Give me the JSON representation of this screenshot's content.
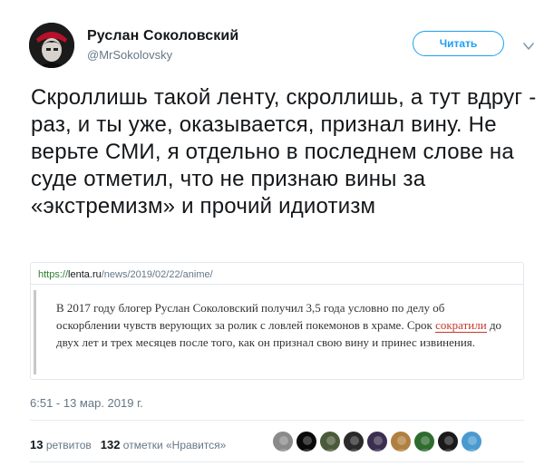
{
  "author": {
    "name": "Руслан Соколовский",
    "handle": "@MrSokolovsky"
  },
  "follow_label": "Читать",
  "tweet_text": "Скроллишь такой ленту, скроллишь, а тут вдруг - раз, и ты уже, оказывается, признал вину. Не верьте СМИ, я отдельно в последнем слове на суде отметил, что не признаю вины за «экстремизм» и прочий идиотизм",
  "card": {
    "url_scheme": "https://",
    "url_host": "lenta.ru",
    "url_path": "/news/2019/02/22/anime/",
    "text_before": "В 2017 году блогер Руслан Соколовский получил 3,5 года условно по делу об оскорблении чувств верующих за ролик с ловлей покемонов в храме. Срок ",
    "text_link": "сократили",
    "text_after": " до двух лет и трех месяцев после того, как он признал свою вину и принес извинения."
  },
  "timestamp": "6:51 - 13 мар. 2019 г.",
  "stats": {
    "retweets_count": "13",
    "retweets_label": "ретвитов",
    "likes_count": "132",
    "likes_label": "отметки «Нравится»"
  },
  "likers": [
    {
      "icon": "liker-avatar-1",
      "color": "#8a8a8a"
    },
    {
      "icon": "liker-avatar-2",
      "color": "#0a0a0a"
    },
    {
      "icon": "liker-avatar-3",
      "color": "#4a5a3a"
    },
    {
      "icon": "liker-avatar-4",
      "color": "#2a2a2a"
    },
    {
      "icon": "liker-avatar-5",
      "color": "#3b2f4f"
    },
    {
      "icon": "liker-avatar-6",
      "color": "#b08040"
    },
    {
      "icon": "liker-avatar-7",
      "color": "#2f6b2f"
    },
    {
      "icon": "liker-avatar-8",
      "color": "#1a1a1a"
    },
    {
      "icon": "liker-avatar-9",
      "color": "#4a9ad0"
    }
  ]
}
